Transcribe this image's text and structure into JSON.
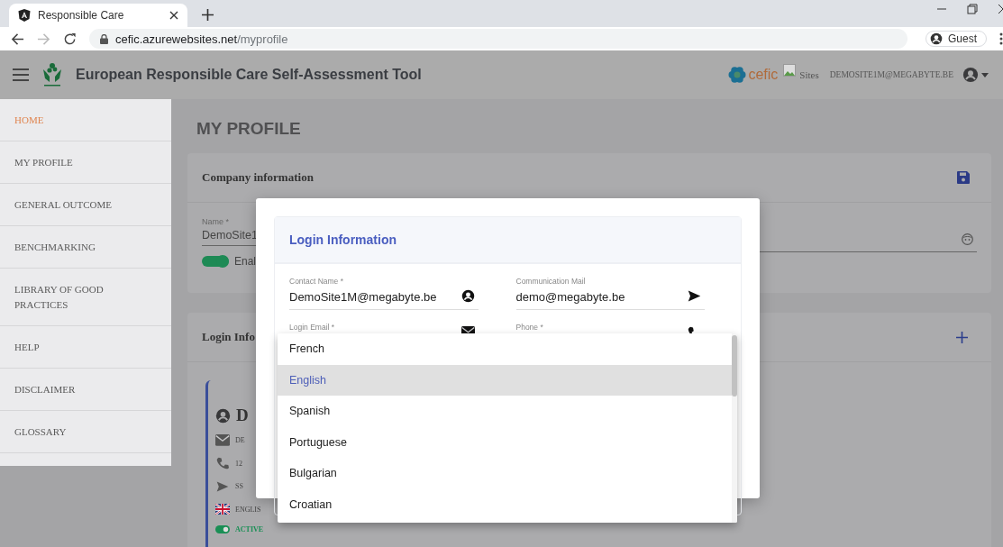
{
  "browser": {
    "tab_title": "Responsible Care",
    "url_host": "cefic.azurewebsites.net",
    "url_path": "/myprofile",
    "profile": "Guest"
  },
  "header": {
    "title": "European Responsible Care Self-Assessment Tool",
    "brand": "cefic",
    "sites": "Sites",
    "user": "DEMOSITE1M@MEGABYTE.BE"
  },
  "sidebar": {
    "items": [
      {
        "label": "HOME",
        "selected": true
      },
      {
        "label": "MY PROFILE",
        "selected": false
      },
      {
        "label": "GENERAL OUTCOME",
        "selected": false
      },
      {
        "label": "BENCHMARKING",
        "selected": false
      },
      {
        "label": "LIBRARY OF GOOD PRACTICES",
        "selected": false
      },
      {
        "label": "HELP",
        "selected": false
      },
      {
        "label": "DISCLAIMER",
        "selected": false
      },
      {
        "label": "GLOSSARY",
        "selected": false
      }
    ]
  },
  "page": {
    "title": "MY PROFILE",
    "company_card": {
      "title": "Company information",
      "name_label": "Name *",
      "name_value": "DemoSite1",
      "toggle_label": "Enal",
      "toggle_on": true
    },
    "login_card": {
      "title": "Login Info",
      "contact": {
        "name": "D",
        "email": "DE",
        "phone": "12",
        "mail": "SS",
        "language": "ENGLIS",
        "status": "ACTIVE",
        "active": true
      }
    }
  },
  "dialog": {
    "title": "Login Information",
    "fields": [
      {
        "label": "Contact Name *",
        "value": "DemoSite1M@megabyte.be"
      },
      {
        "label": "Communication Mail",
        "value": "demo@megabyte.be"
      },
      {
        "label": "Login Email *"
      },
      {
        "label": "Phone *"
      }
    ]
  },
  "dropdown": {
    "options": [
      {
        "label": "French",
        "selected": false
      },
      {
        "label": "English",
        "selected": true
      },
      {
        "label": "Spanish",
        "selected": false
      },
      {
        "label": "Portuguese",
        "selected": false
      },
      {
        "label": "Bulgarian",
        "selected": false
      },
      {
        "label": "Croatian",
        "selected": false
      }
    ]
  }
}
